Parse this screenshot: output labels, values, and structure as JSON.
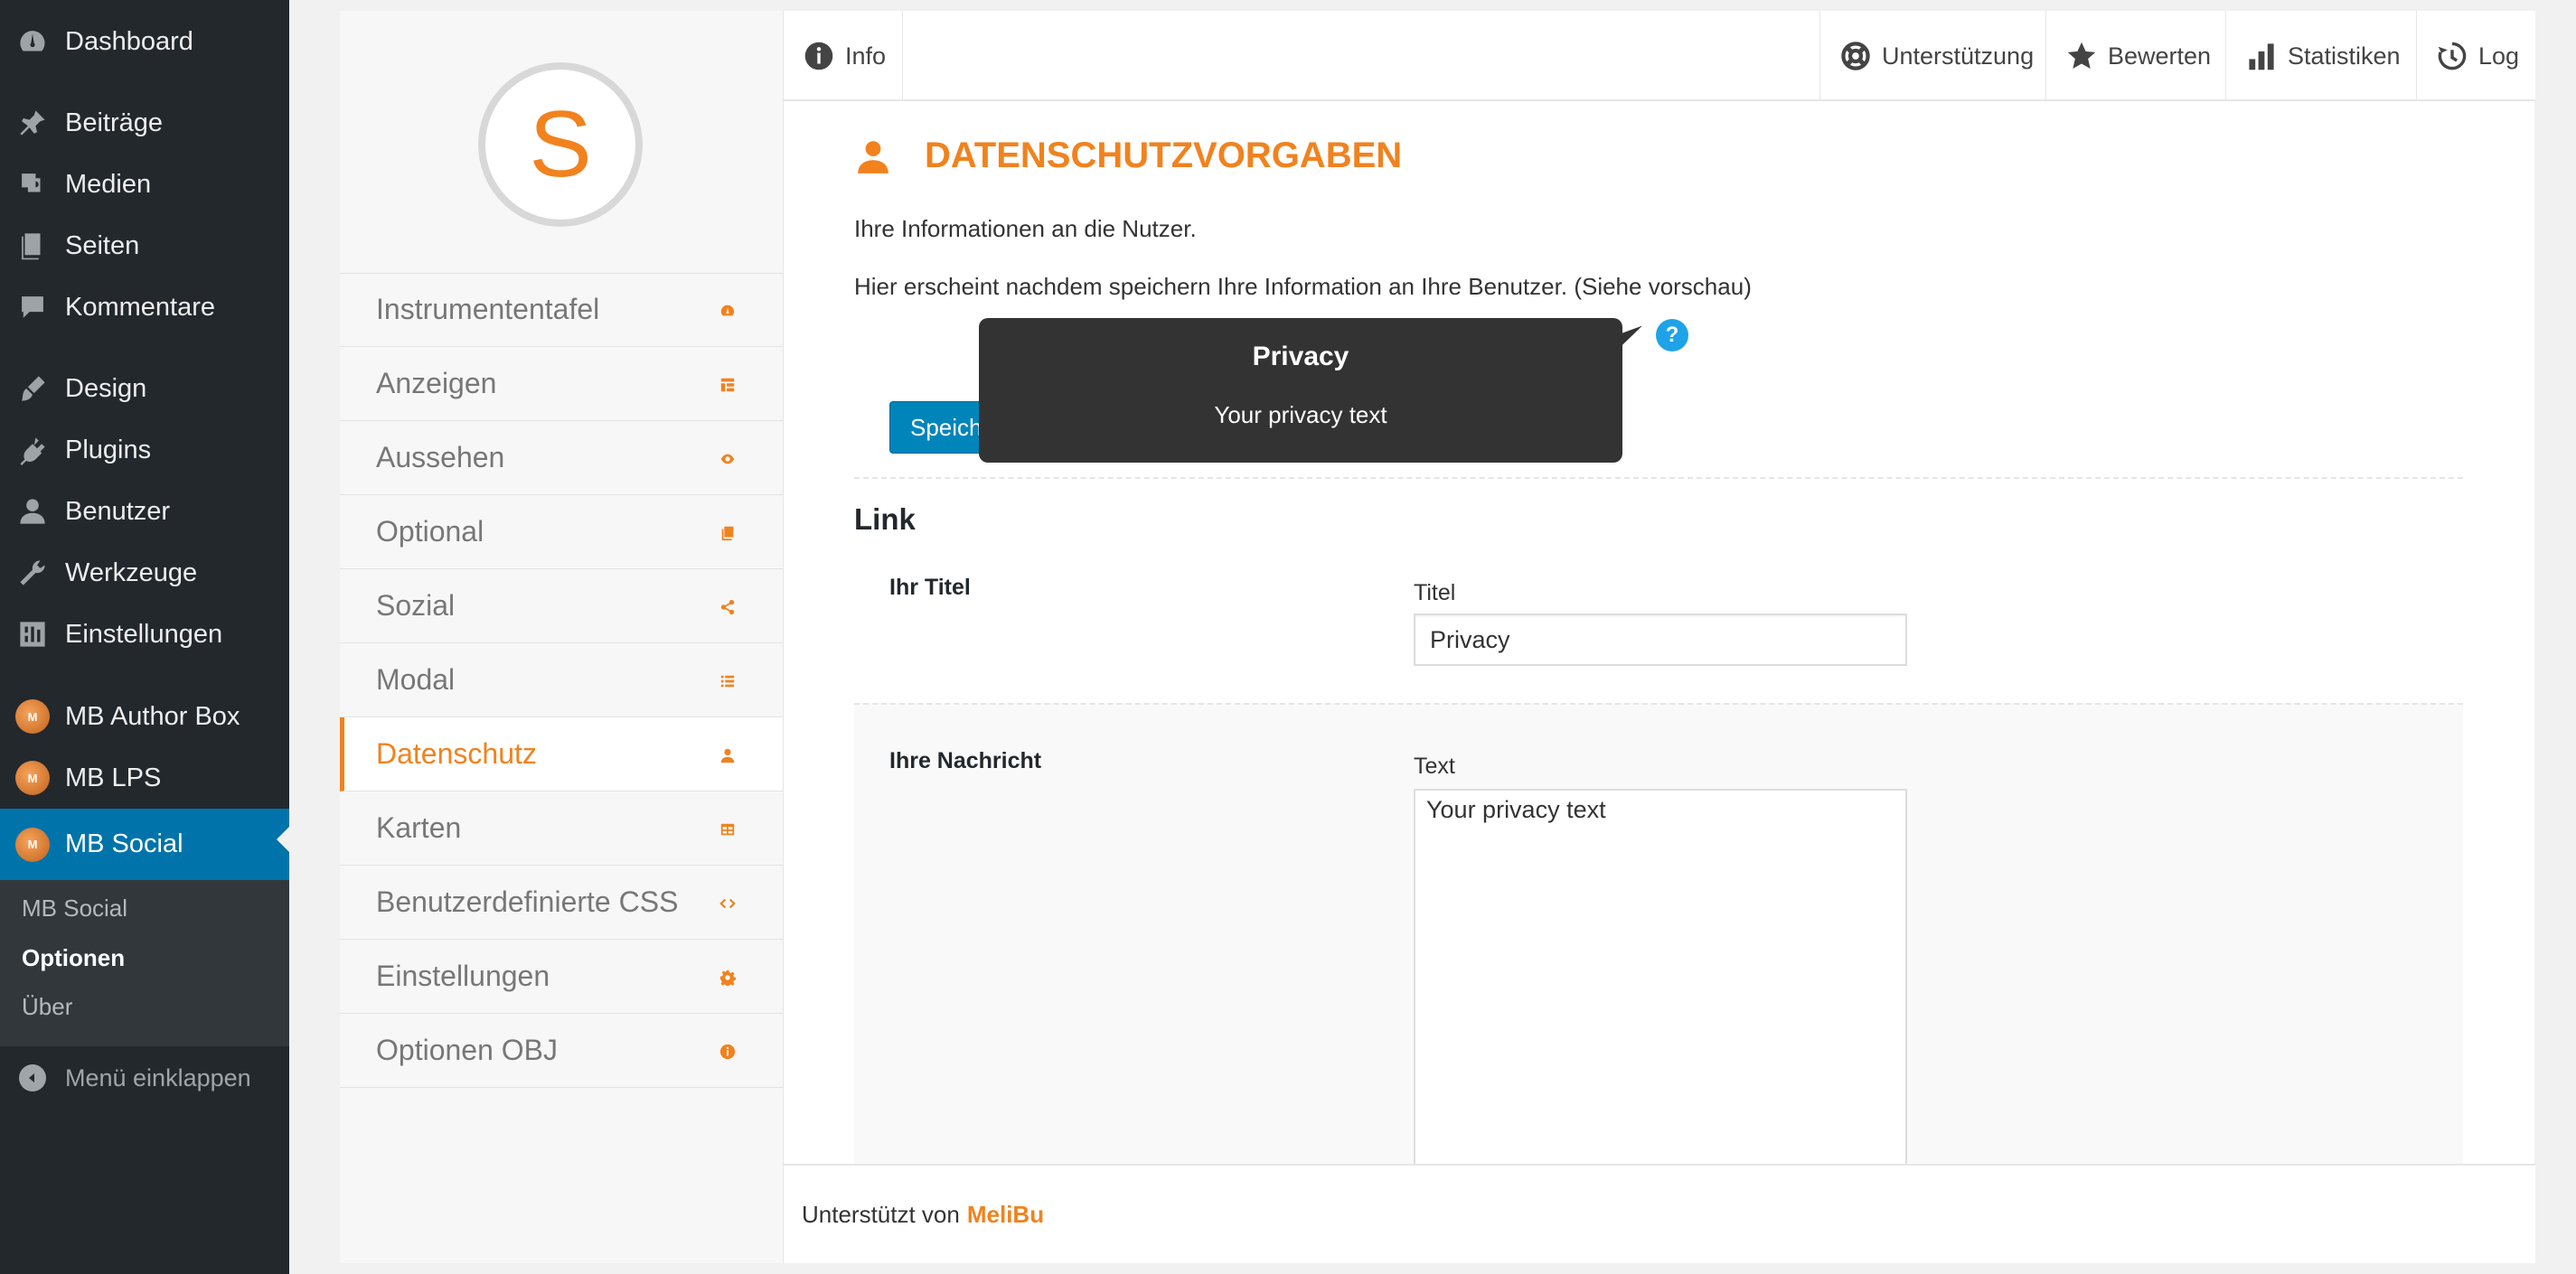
{
  "wp_menu": {
    "items": [
      {
        "label": "Dashboard",
        "icon": "dashboard-icon"
      },
      {
        "label": "Beiträge",
        "icon": "pin-icon"
      },
      {
        "label": "Medien",
        "icon": "media-icon"
      },
      {
        "label": "Seiten",
        "icon": "pages-icon"
      },
      {
        "label": "Kommentare",
        "icon": "comment-icon"
      },
      {
        "label": "Design",
        "icon": "brush-icon"
      },
      {
        "label": "Plugins",
        "icon": "plugin-icon"
      },
      {
        "label": "Benutzer",
        "icon": "user-icon"
      },
      {
        "label": "Werkzeuge",
        "icon": "wrench-icon"
      },
      {
        "label": "Einstellungen",
        "icon": "settings-icon"
      },
      {
        "label": "MB Author Box",
        "icon": "mb-logo-icon"
      },
      {
        "label": "MB LPS",
        "icon": "mb-logo-icon"
      },
      {
        "label": "MB Social",
        "icon": "mb-logo-icon",
        "active": true
      }
    ],
    "submenu": [
      "MB Social",
      "Optionen",
      "Über"
    ],
    "collapse_label": "Menü einklappen"
  },
  "plugin_nav": {
    "logo_letter": "S",
    "items": [
      {
        "label": "Instrumententafel",
        "icon": "dashboard-icon"
      },
      {
        "label": "Anzeigen",
        "icon": "layout-icon"
      },
      {
        "label": "Aussehen",
        "icon": "eye-icon"
      },
      {
        "label": "Optional",
        "icon": "copy-icon"
      },
      {
        "label": "Sozial",
        "icon": "share-icon"
      },
      {
        "label": "Modal",
        "icon": "list-icon"
      },
      {
        "label": "Datenschutz",
        "icon": "user-icon",
        "active": true
      },
      {
        "label": "Karten",
        "icon": "table-icon"
      },
      {
        "label": "Benutzerdefinierte CSS",
        "icon": "code-icon"
      },
      {
        "label": "Einstellungen",
        "icon": "gear-icon"
      },
      {
        "label": "Optionen OBJ",
        "icon": "info-icon"
      }
    ]
  },
  "topbar": {
    "info": "Info",
    "support": "Unterstützung",
    "rate": "Bewerten",
    "stats": "Statistiken",
    "log": "Log"
  },
  "section": {
    "title": "DATENSCHUTZVORGABEN",
    "intro": "Ihre Informationen an die Nutzer.",
    "description": "Hier erscheint nachdem speichern Ihre Information an Ihre Benutzer. (Siehe vorschau)",
    "help": "?",
    "save_button": "Speichern"
  },
  "tooltip": {
    "title": "Privacy",
    "text": "Your privacy text"
  },
  "link_section": {
    "title": "Link",
    "title_row_label": "Ihr Titel",
    "title_field_label": "Titel",
    "title_value": "Privacy",
    "message_row_label": "Ihre Nachricht",
    "text_field_label": "Text",
    "text_value": "Your privacy text"
  },
  "footer": {
    "powered_by": "Unterstützt von",
    "brand": "MeliBu"
  }
}
